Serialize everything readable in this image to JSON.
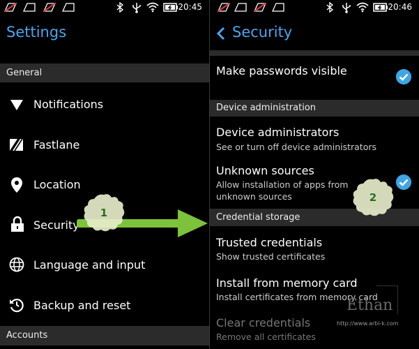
{
  "status": {
    "time_left": "20:45",
    "time_right": "20:46"
  },
  "left": {
    "title": "Settings",
    "section_general": "General",
    "items": [
      {
        "label": "Notifications",
        "icon": "notifications-icon"
      },
      {
        "label": "Fastlane",
        "icon": "fastlane-icon"
      },
      {
        "label": "Location",
        "icon": "location-icon"
      },
      {
        "label": "Security",
        "icon": "lock-icon"
      },
      {
        "label": "Language and input",
        "icon": "globe-icon"
      },
      {
        "label": "Backup and reset",
        "icon": "backup-icon"
      }
    ],
    "section_accounts": "Accounts"
  },
  "right": {
    "title": "Security",
    "make_passwords_visible": "Make passwords visible",
    "section_device_admin": "Device administration",
    "device_admins_title": "Device administrators",
    "device_admins_sub": "See or turn off device administrators",
    "unknown_sources_title": "Unknown sources",
    "unknown_sources_sub1": "Allow installation of apps from",
    "unknown_sources_sub2": "unknown sources",
    "section_credential": "Credential storage",
    "trusted_title": "Trusted credentials",
    "trusted_sub": "Show trusted certificates",
    "install_title": "Install from memory card",
    "install_sub": "Install certificates from memory card",
    "clear_title": "Clear credentials",
    "clear_sub": "Remove all certificates"
  },
  "annotations": {
    "step1": "1",
    "step2": "2"
  },
  "watermark": {
    "name": "Ethan",
    "url": "http://www.arbi-k.com"
  },
  "colors": {
    "accent": "#4aa6ee",
    "check": "#3fa6e6",
    "arrow": "#7cc23a",
    "section_bg": "#2b2b2b"
  }
}
